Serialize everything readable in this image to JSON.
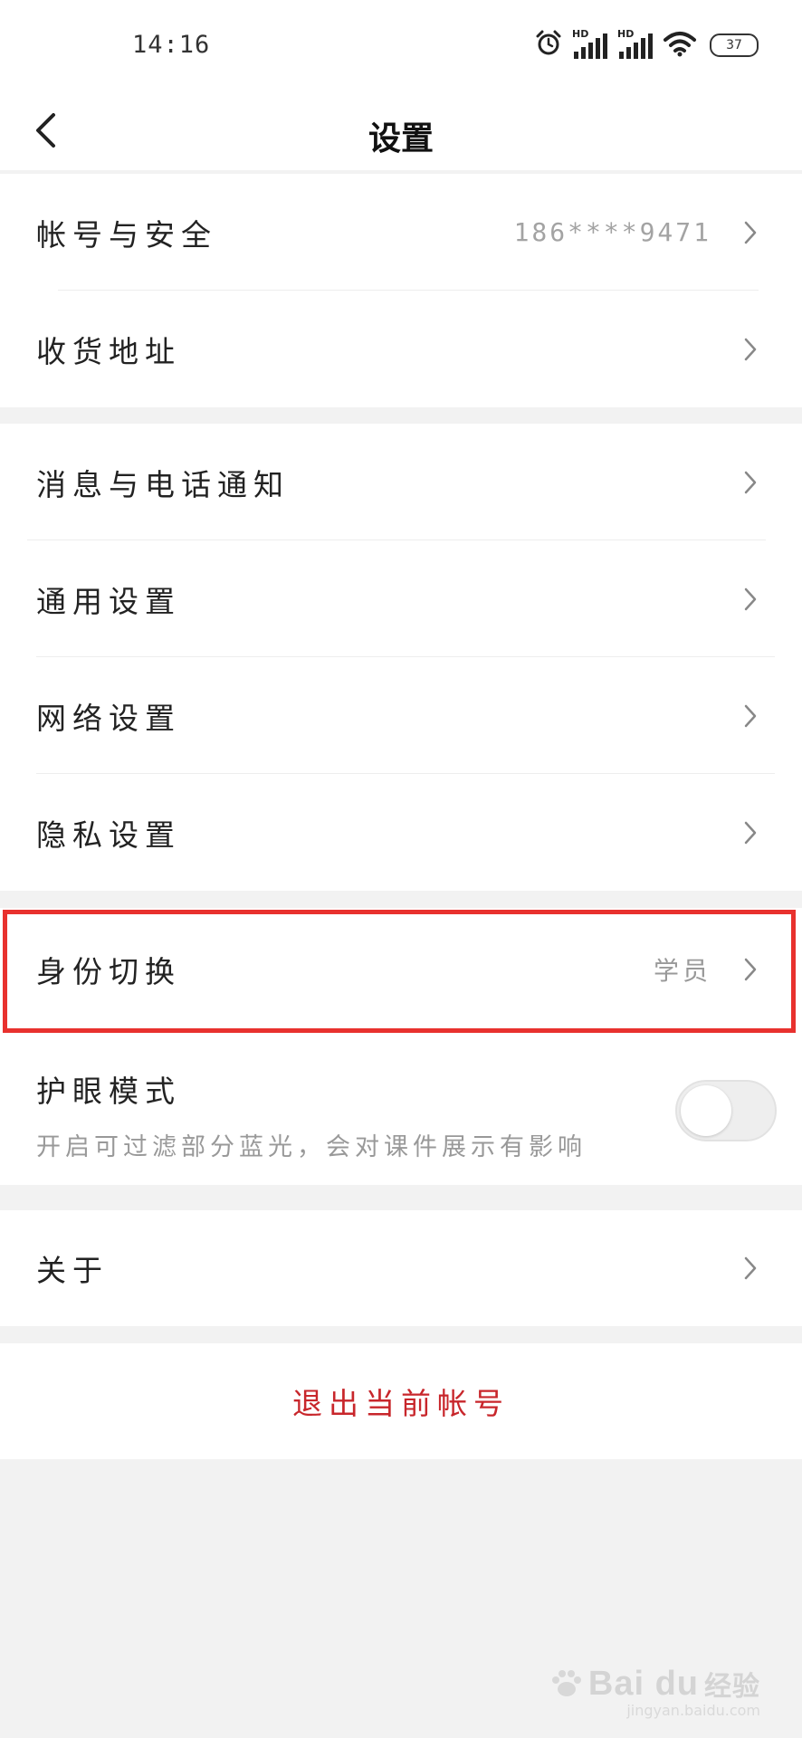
{
  "status_bar": {
    "time": "14:16",
    "hd_label": "HD",
    "battery": "37"
  },
  "nav": {
    "title": "设置"
  },
  "sections": {
    "account": [
      {
        "label": "帐号与安全",
        "value": "186****9471"
      },
      {
        "label": "收货地址",
        "value": ""
      }
    ],
    "general": [
      {
        "label": "消息与电话通知"
      },
      {
        "label": "通用设置"
      },
      {
        "label": "网络设置"
      },
      {
        "label": "隐私设置"
      }
    ],
    "identity": {
      "label": "身份切换",
      "value": "学员"
    },
    "eye_protection": {
      "label": "护眼模式",
      "subtitle": "开启可过滤部分蓝光，会对课件展示有影响",
      "enabled": false
    },
    "about": {
      "label": "关于"
    }
  },
  "logout_label": "退出当前帐号",
  "colors": {
    "highlight": "#e8312e",
    "logout_text": "#c8262b",
    "background": "#f2f2f2"
  },
  "watermark": {
    "brand": "Bai du",
    "tagline": "经验",
    "sub": "jingyan.baidu.com"
  }
}
